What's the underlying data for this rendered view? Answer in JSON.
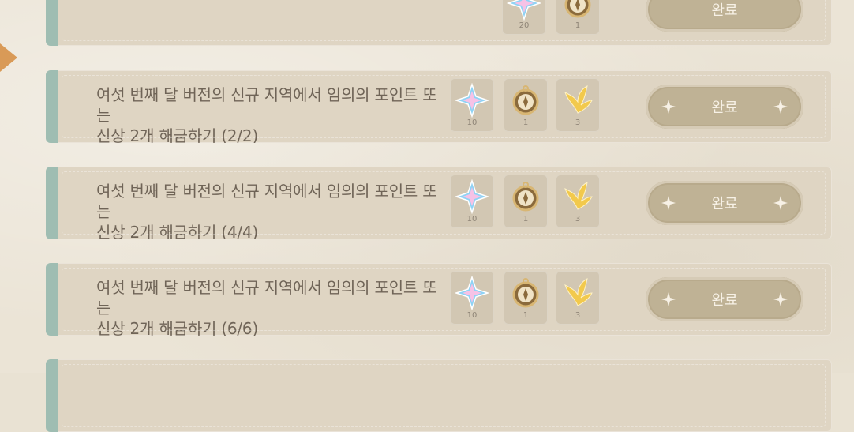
{
  "quests": [
    {
      "line1": "",
      "line2": "",
      "progress": "",
      "rewards": [
        {
          "icon": "primogem-icon",
          "count": "20"
        },
        {
          "icon": "compass-icon",
          "count": "1"
        }
      ],
      "button": "완료"
    },
    {
      "line1": "여섯 번째 달 버전의 신규 지역에서 임의의 포인트 또는",
      "line2": "신상 2개 해금하기",
      "progress": "(2/2)",
      "rewards": [
        {
          "icon": "primogem-icon",
          "count": "10"
        },
        {
          "icon": "compass-icon",
          "count": "1"
        },
        {
          "icon": "wing-icon",
          "count": "3"
        }
      ],
      "button": "완료"
    },
    {
      "line1": "여섯 번째 달 버전의 신규 지역에서 임의의 포인트 또는",
      "line2": "신상 2개 해금하기",
      "progress": "(4/4)",
      "rewards": [
        {
          "icon": "primogem-icon",
          "count": "10"
        },
        {
          "icon": "compass-icon",
          "count": "1"
        },
        {
          "icon": "wing-icon",
          "count": "3"
        }
      ],
      "button": "완료"
    },
    {
      "line1": "여섯 번째 달 버전의 신규 지역에서 임의의 포인트 또는",
      "line2": "신상 2개 해금하기",
      "progress": "(6/6)",
      "rewards": [
        {
          "icon": "primogem-icon",
          "count": "10"
        },
        {
          "icon": "compass-icon",
          "count": "1"
        },
        {
          "icon": "wing-icon",
          "count": "3"
        }
      ],
      "button": "완료"
    }
  ],
  "colors": {
    "accent_stripe": "#9fbdb2",
    "button_bg": "#bfb295",
    "text": "#6f6457"
  }
}
